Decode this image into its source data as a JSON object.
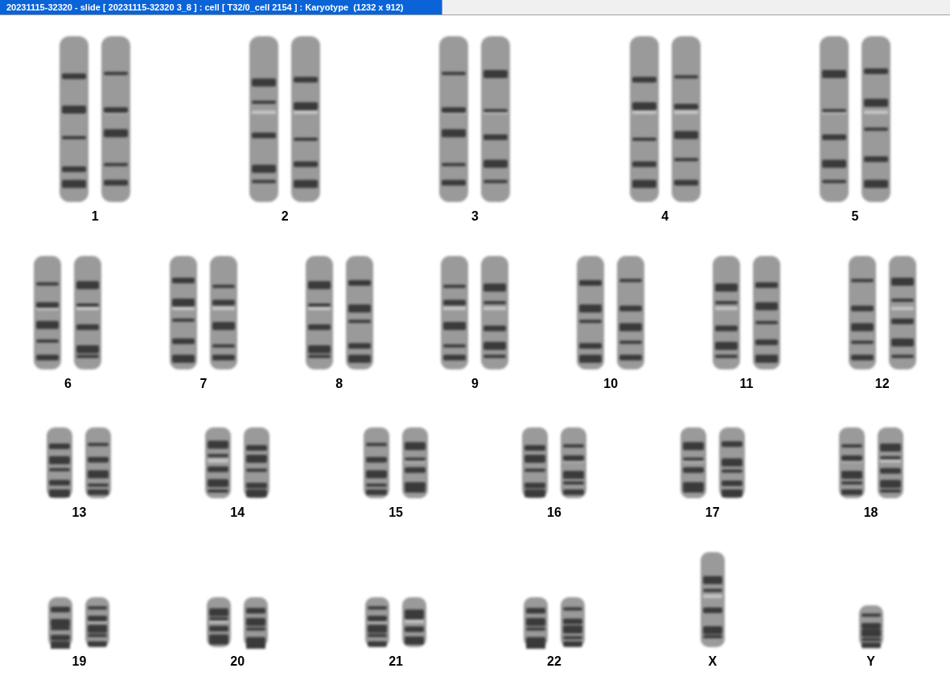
{
  "window": {
    "title": "20231115-32320 - slide [ 20231115-32320 3_8 ] : cell [ T32/0_cell 2154 ] : Karyotype  (1232 x 912)"
  },
  "karyotype": {
    "rows": [
      {
        "chromosomes": [
          {
            "label": "1",
            "kind": "pair"
          },
          {
            "label": "2",
            "kind": "pair"
          },
          {
            "label": "3",
            "kind": "pair"
          },
          {
            "label": "4",
            "kind": "pair"
          },
          {
            "label": "5",
            "kind": "pair"
          }
        ]
      },
      {
        "chromosomes": [
          {
            "label": "6",
            "kind": "pair"
          },
          {
            "label": "7",
            "kind": "pair"
          },
          {
            "label": "8",
            "kind": "pair"
          },
          {
            "label": "9",
            "kind": "pair"
          },
          {
            "label": "10",
            "kind": "pair"
          },
          {
            "label": "11",
            "kind": "pair"
          },
          {
            "label": "12",
            "kind": "pair"
          }
        ]
      },
      {
        "chromosomes": [
          {
            "label": "13",
            "kind": "pair"
          },
          {
            "label": "14",
            "kind": "pair"
          },
          {
            "label": "15",
            "kind": "pair"
          },
          {
            "label": "16",
            "kind": "pair"
          },
          {
            "label": "17",
            "kind": "pair"
          },
          {
            "label": "18",
            "kind": "pair"
          }
        ]
      },
      {
        "chromosomes": [
          {
            "label": "19",
            "kind": "pair"
          },
          {
            "label": "20",
            "kind": "pair"
          },
          {
            "label": "21",
            "kind": "pair"
          },
          {
            "label": "22",
            "kind": "pair"
          },
          {
            "label": "X",
            "kind": "single"
          },
          {
            "label": "Y",
            "kind": "single"
          }
        ]
      }
    ]
  }
}
